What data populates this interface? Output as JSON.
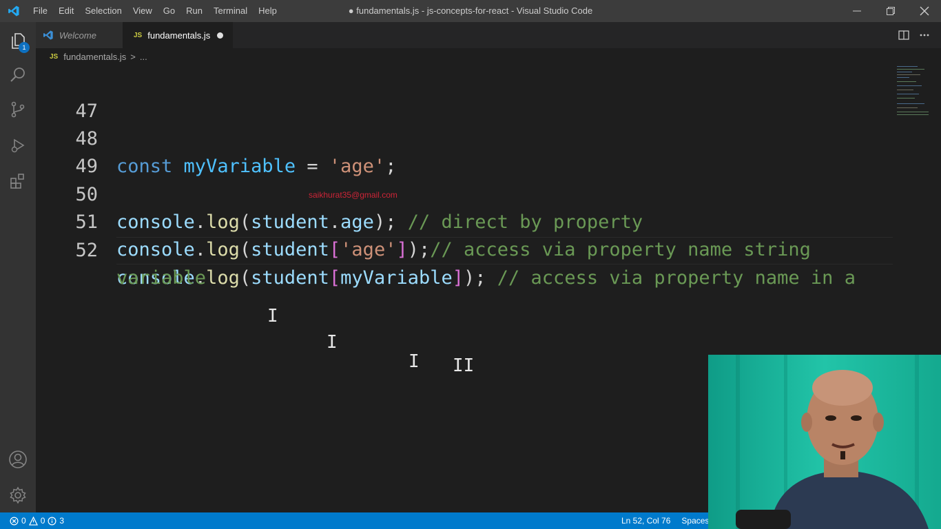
{
  "window": {
    "title": "● fundamentals.js - js-concepts-for-react - Visual Studio Code",
    "menu": [
      "File",
      "Edit",
      "Selection",
      "View",
      "Go",
      "Run",
      "Terminal",
      "Help"
    ]
  },
  "activity": {
    "explorer_badge": "1",
    "icons": [
      "files-icon",
      "search-icon",
      "source-control-icon",
      "run-debug-icon",
      "extensions-icon",
      "account-icon",
      "settings-gear-icon"
    ]
  },
  "tabs": [
    {
      "label": "Welcome",
      "active": false
    },
    {
      "label": "fundamentals.js",
      "active": true,
      "dirty": true,
      "lang_badge": "JS"
    }
  ],
  "breadcrumb": {
    "lang_badge": "JS",
    "file": "fundamentals.js",
    "separator": ">",
    "rest": "..."
  },
  "editor": {
    "lines": [
      {
        "number": "47",
        "text": ""
      },
      {
        "number": "48",
        "text": "const myVariable = 'age';"
      },
      {
        "number": "49",
        "text": ""
      },
      {
        "number": "50",
        "text": "console.log(student.age); // direct by property"
      },
      {
        "number": "51",
        "text": "console.log(student['age']);// access via property name string"
      },
      {
        "number": "52",
        "text": "console.log(student[myVariable]); // access via property name in a variable"
      }
    ],
    "wrapped_continuation": "variable",
    "watermark": "saikhurat35@gmail.com"
  },
  "statusbar": {
    "errors": "0",
    "warnings": "0",
    "info": "3",
    "cursor_position": "Ln 52, Col 76",
    "indentation": "Spaces"
  },
  "colors": {
    "accent": "#007acc",
    "editor_bg": "#1e1e1e",
    "keyword": "#569cd6",
    "string": "#ce9178",
    "comment": "#6a9955",
    "function": "#dcdcaa"
  }
}
